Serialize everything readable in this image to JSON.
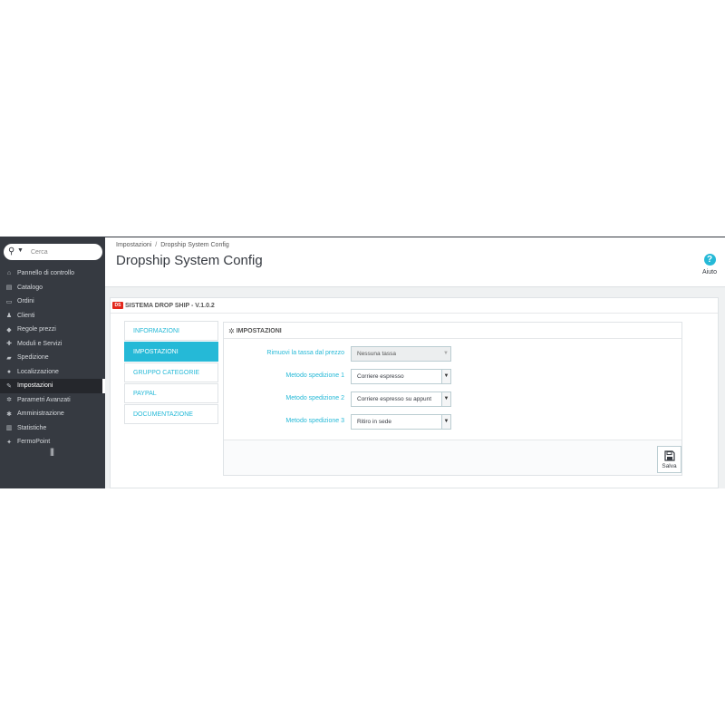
{
  "search": {
    "placeholder": "Cerca"
  },
  "sidebar": {
    "items": [
      {
        "label": "Pannello di controllo",
        "icon": "dashboard-icon",
        "glyph": "⌂"
      },
      {
        "label": "Catalogo",
        "icon": "catalog-icon",
        "glyph": "▤"
      },
      {
        "label": "Ordini",
        "icon": "orders-icon",
        "glyph": "▭"
      },
      {
        "label": "Clienti",
        "icon": "customers-icon",
        "glyph": "♟"
      },
      {
        "label": "Regole prezzi",
        "icon": "price-rules-icon",
        "glyph": "◆"
      },
      {
        "label": "Moduli e Servizi",
        "icon": "modules-icon",
        "glyph": "✚"
      },
      {
        "label": "Spedizione",
        "icon": "shipping-icon",
        "glyph": "▰"
      },
      {
        "label": "Localizzazione",
        "icon": "globe-icon",
        "glyph": "●"
      },
      {
        "label": "Impostazioni",
        "icon": "wrench-icon",
        "glyph": "✎",
        "active": true
      },
      {
        "label": "Parametri Avanzati",
        "icon": "cogs-icon",
        "glyph": "✲"
      },
      {
        "label": "Amministrazione",
        "icon": "gear-icon",
        "glyph": "✱"
      },
      {
        "label": "Statistiche",
        "icon": "chart-icon",
        "glyph": "▥"
      },
      {
        "label": "FermoPoint",
        "icon": "plugin-icon",
        "glyph": "✦"
      }
    ],
    "toggle_glyph": "|||"
  },
  "breadcrumb": {
    "parent": "Impostazioni",
    "separator": "/",
    "current": "Dropship System Config"
  },
  "page": {
    "title": "Dropship System Config"
  },
  "help": {
    "glyph": "?",
    "label": "Aiuto"
  },
  "module": {
    "logo_text": "DS",
    "title": "SISTEMA DROP SHIP - V.1.0.2"
  },
  "tabs": [
    {
      "label": "INFORMAZIONI"
    },
    {
      "label": "IMPOSTAZIONI",
      "active": true
    },
    {
      "label": "GRUPPO CATEGORIE"
    },
    {
      "label": "PAYPAL"
    },
    {
      "label": "DOCUMENTAZIONE"
    }
  ],
  "settings": {
    "title": "IMPOSTAZIONI",
    "fields": [
      {
        "label": "Rimuovi la tassa dal prezzo",
        "value": "Nessuna tassa",
        "disabled": true
      },
      {
        "label": "Metodo spedizione 1",
        "value": "Corriere espresso"
      },
      {
        "label": "Metodo spedizione 2",
        "value": "Corriere espresso su appunt"
      },
      {
        "label": "Metodo spedizione 3",
        "value": "Ritiro in sede"
      }
    ],
    "save_label": "Salva"
  },
  "colors": {
    "sidebar": "#363a41",
    "accent": "#25b9d7",
    "brand_red": "#e3271b"
  }
}
